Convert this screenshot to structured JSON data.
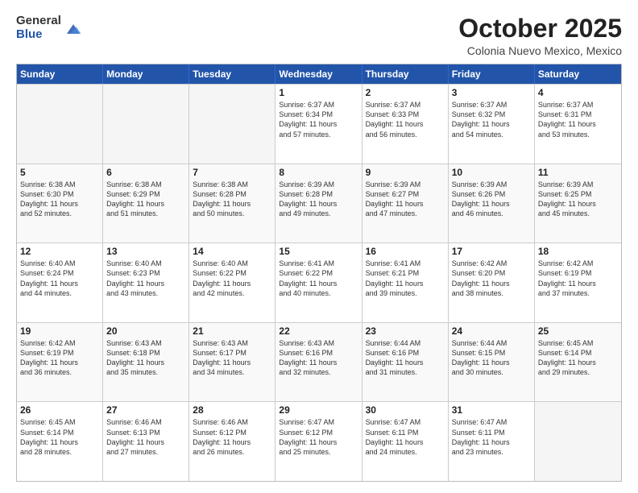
{
  "logo": {
    "general": "General",
    "blue": "Blue"
  },
  "header": {
    "month": "October 2025",
    "location": "Colonia Nuevo Mexico, Mexico"
  },
  "days": [
    "Sunday",
    "Monday",
    "Tuesday",
    "Wednesday",
    "Thursday",
    "Friday",
    "Saturday"
  ],
  "weeks": [
    [
      {
        "day": "",
        "lines": []
      },
      {
        "day": "",
        "lines": []
      },
      {
        "day": "",
        "lines": []
      },
      {
        "day": "1",
        "lines": [
          "Sunrise: 6:37 AM",
          "Sunset: 6:34 PM",
          "Daylight: 11 hours",
          "and 57 minutes."
        ]
      },
      {
        "day": "2",
        "lines": [
          "Sunrise: 6:37 AM",
          "Sunset: 6:33 PM",
          "Daylight: 11 hours",
          "and 56 minutes."
        ]
      },
      {
        "day": "3",
        "lines": [
          "Sunrise: 6:37 AM",
          "Sunset: 6:32 PM",
          "Daylight: 11 hours",
          "and 54 minutes."
        ]
      },
      {
        "day": "4",
        "lines": [
          "Sunrise: 6:37 AM",
          "Sunset: 6:31 PM",
          "Daylight: 11 hours",
          "and 53 minutes."
        ]
      }
    ],
    [
      {
        "day": "5",
        "lines": [
          "Sunrise: 6:38 AM",
          "Sunset: 6:30 PM",
          "Daylight: 11 hours",
          "and 52 minutes."
        ]
      },
      {
        "day": "6",
        "lines": [
          "Sunrise: 6:38 AM",
          "Sunset: 6:29 PM",
          "Daylight: 11 hours",
          "and 51 minutes."
        ]
      },
      {
        "day": "7",
        "lines": [
          "Sunrise: 6:38 AM",
          "Sunset: 6:28 PM",
          "Daylight: 11 hours",
          "and 50 minutes."
        ]
      },
      {
        "day": "8",
        "lines": [
          "Sunrise: 6:39 AM",
          "Sunset: 6:28 PM",
          "Daylight: 11 hours",
          "and 49 minutes."
        ]
      },
      {
        "day": "9",
        "lines": [
          "Sunrise: 6:39 AM",
          "Sunset: 6:27 PM",
          "Daylight: 11 hours",
          "and 47 minutes."
        ]
      },
      {
        "day": "10",
        "lines": [
          "Sunrise: 6:39 AM",
          "Sunset: 6:26 PM",
          "Daylight: 11 hours",
          "and 46 minutes."
        ]
      },
      {
        "day": "11",
        "lines": [
          "Sunrise: 6:39 AM",
          "Sunset: 6:25 PM",
          "Daylight: 11 hours",
          "and 45 minutes."
        ]
      }
    ],
    [
      {
        "day": "12",
        "lines": [
          "Sunrise: 6:40 AM",
          "Sunset: 6:24 PM",
          "Daylight: 11 hours",
          "and 44 minutes."
        ]
      },
      {
        "day": "13",
        "lines": [
          "Sunrise: 6:40 AM",
          "Sunset: 6:23 PM",
          "Daylight: 11 hours",
          "and 43 minutes."
        ]
      },
      {
        "day": "14",
        "lines": [
          "Sunrise: 6:40 AM",
          "Sunset: 6:22 PM",
          "Daylight: 11 hours",
          "and 42 minutes."
        ]
      },
      {
        "day": "15",
        "lines": [
          "Sunrise: 6:41 AM",
          "Sunset: 6:22 PM",
          "Daylight: 11 hours",
          "and 40 minutes."
        ]
      },
      {
        "day": "16",
        "lines": [
          "Sunrise: 6:41 AM",
          "Sunset: 6:21 PM",
          "Daylight: 11 hours",
          "and 39 minutes."
        ]
      },
      {
        "day": "17",
        "lines": [
          "Sunrise: 6:42 AM",
          "Sunset: 6:20 PM",
          "Daylight: 11 hours",
          "and 38 minutes."
        ]
      },
      {
        "day": "18",
        "lines": [
          "Sunrise: 6:42 AM",
          "Sunset: 6:19 PM",
          "Daylight: 11 hours",
          "and 37 minutes."
        ]
      }
    ],
    [
      {
        "day": "19",
        "lines": [
          "Sunrise: 6:42 AM",
          "Sunset: 6:19 PM",
          "Daylight: 11 hours",
          "and 36 minutes."
        ]
      },
      {
        "day": "20",
        "lines": [
          "Sunrise: 6:43 AM",
          "Sunset: 6:18 PM",
          "Daylight: 11 hours",
          "and 35 minutes."
        ]
      },
      {
        "day": "21",
        "lines": [
          "Sunrise: 6:43 AM",
          "Sunset: 6:17 PM",
          "Daylight: 11 hours",
          "and 34 minutes."
        ]
      },
      {
        "day": "22",
        "lines": [
          "Sunrise: 6:43 AM",
          "Sunset: 6:16 PM",
          "Daylight: 11 hours",
          "and 32 minutes."
        ]
      },
      {
        "day": "23",
        "lines": [
          "Sunrise: 6:44 AM",
          "Sunset: 6:16 PM",
          "Daylight: 11 hours",
          "and 31 minutes."
        ]
      },
      {
        "day": "24",
        "lines": [
          "Sunrise: 6:44 AM",
          "Sunset: 6:15 PM",
          "Daylight: 11 hours",
          "and 30 minutes."
        ]
      },
      {
        "day": "25",
        "lines": [
          "Sunrise: 6:45 AM",
          "Sunset: 6:14 PM",
          "Daylight: 11 hours",
          "and 29 minutes."
        ]
      }
    ],
    [
      {
        "day": "26",
        "lines": [
          "Sunrise: 6:45 AM",
          "Sunset: 6:14 PM",
          "Daylight: 11 hours",
          "and 28 minutes."
        ]
      },
      {
        "day": "27",
        "lines": [
          "Sunrise: 6:46 AM",
          "Sunset: 6:13 PM",
          "Daylight: 11 hours",
          "and 27 minutes."
        ]
      },
      {
        "day": "28",
        "lines": [
          "Sunrise: 6:46 AM",
          "Sunset: 6:12 PM",
          "Daylight: 11 hours",
          "and 26 minutes."
        ]
      },
      {
        "day": "29",
        "lines": [
          "Sunrise: 6:47 AM",
          "Sunset: 6:12 PM",
          "Daylight: 11 hours",
          "and 25 minutes."
        ]
      },
      {
        "day": "30",
        "lines": [
          "Sunrise: 6:47 AM",
          "Sunset: 6:11 PM",
          "Daylight: 11 hours",
          "and 24 minutes."
        ]
      },
      {
        "day": "31",
        "lines": [
          "Sunrise: 6:47 AM",
          "Sunset: 6:11 PM",
          "Daylight: 11 hours",
          "and 23 minutes."
        ]
      },
      {
        "day": "",
        "lines": []
      }
    ]
  ]
}
